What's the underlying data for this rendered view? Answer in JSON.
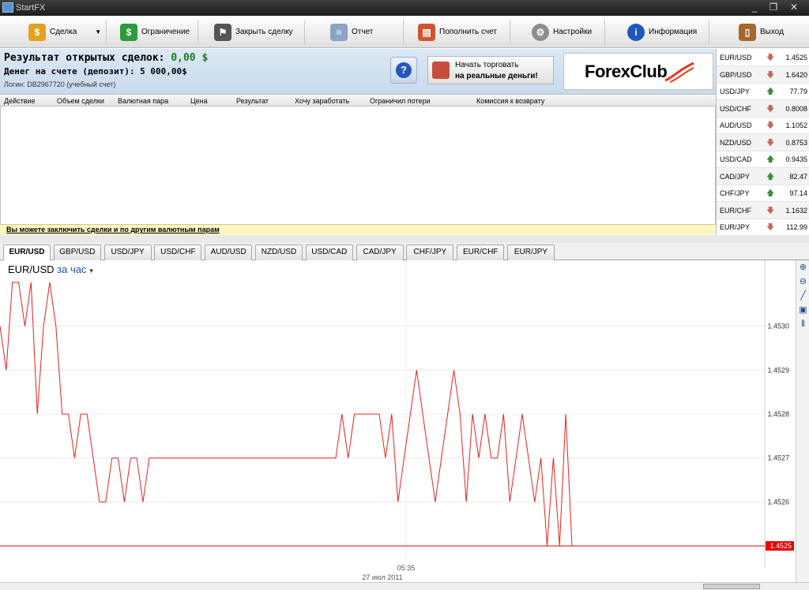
{
  "window": {
    "title": "StartFX"
  },
  "toolbar": {
    "deal": "Сделка",
    "limit": "Ограничение",
    "close_deal": "Закрыть сделку",
    "report": "Отчет",
    "deposit": "Пополнить счет",
    "settings": "Настройки",
    "info": "Информация",
    "exit": "Выход"
  },
  "account": {
    "result_label": "Результат открытых сделок:",
    "result_value": "0,00 $",
    "deposit_text": "Денег на счете (депозит): 5 000,00$",
    "login_text": "Логин: DB2967720 (учебный счет)",
    "help_label": "?",
    "real_money_line1": "Начать торговать",
    "real_money_line2": "на реальные деньги!",
    "logo_text": "ForexClub"
  },
  "table": {
    "columns": [
      "Действие",
      "Объем сделки",
      "Валютная пара",
      "Цена",
      "Результат",
      "Хочу заработать",
      "Ограничил потери",
      "Комиссия к возврату"
    ]
  },
  "notice": "Вы можете заключить сделки и по другим валютным парам",
  "quotes": [
    {
      "pair": "EUR/USD",
      "dir": "down",
      "value": "1.4525"
    },
    {
      "pair": "GBP/USD",
      "dir": "down",
      "value": "1.6420"
    },
    {
      "pair": "USD/JPY",
      "dir": "up",
      "value": "77.79"
    },
    {
      "pair": "USD/CHF",
      "dir": "down",
      "value": "0.8008"
    },
    {
      "pair": "AUD/USD",
      "dir": "down",
      "value": "1.1052"
    },
    {
      "pair": "NZD/USD",
      "dir": "down",
      "value": "0.8753"
    },
    {
      "pair": "USD/CAD",
      "dir": "up",
      "value": "0.9435"
    },
    {
      "pair": "CAD/JPY",
      "dir": "up",
      "value": "82.47"
    },
    {
      "pair": "CHF/JPY",
      "dir": "up",
      "value": "97.14"
    },
    {
      "pair": "EUR/CHF",
      "dir": "down",
      "value": "1.1632"
    },
    {
      "pair": "EUR/JPY",
      "dir": "down",
      "value": "112.99"
    }
  ],
  "tabs": [
    "EUR/USD",
    "GBP/USD",
    "USD/JPY",
    "USD/CHF",
    "AUD/USD",
    "NZD/USD",
    "USD/CAD",
    "CAD/JPY",
    "CHF/JPY",
    "EUR/CHF",
    "EUR/JPY"
  ],
  "active_tab": "EUR/USD",
  "chart": {
    "pair": "EUR/USD",
    "period": "за час",
    "time_label": "05:35",
    "date_label": "27 июл 2011",
    "current_price": "1.4525"
  },
  "colors": {
    "line": "#e82020",
    "price_tag": "#e80000",
    "up": "#3c8a3c",
    "down": "#c86464"
  },
  "chart_data": {
    "type": "line",
    "title": "EUR/USD",
    "y_ticks": [
      1.4526,
      1.4527,
      1.4528,
      1.4529,
      1.453
    ],
    "ylim": [
      1.45245,
      1.45315
    ],
    "series": [
      {
        "values": [
          1.453,
          1.4529,
          1.4531,
          1.4531,
          1.453,
          1.4531,
          1.4528,
          1.453,
          1.4531,
          1.453,
          1.4528,
          1.4528,
          1.4527,
          1.4528,
          1.4528,
          1.4527,
          1.4526,
          1.4526,
          1.4527,
          1.4527,
          1.4526,
          1.4527,
          1.4527,
          1.4526,
          1.4527,
          1.4527,
          1.4527,
          1.4527,
          1.4527,
          1.4527,
          1.4527,
          1.4527,
          1.4527,
          1.4527,
          1.4527,
          1.4527,
          1.4527,
          1.4527,
          1.4527,
          1.4527,
          1.4527,
          1.4527,
          1.4527,
          1.4527,
          1.4527,
          1.4527,
          1.4527,
          1.4527,
          1.4527,
          1.4527,
          1.4527,
          1.4527,
          1.4527,
          1.4527,
          1.4527,
          1.4528,
          1.4527,
          1.4528,
          1.4528,
          1.4528,
          1.4528,
          1.4528,
          1.4527,
          1.4528,
          1.4526,
          1.4527,
          1.4528,
          1.4529,
          1.4528,
          1.4527,
          1.4526,
          1.4527,
          1.4528,
          1.4529,
          1.4528,
          1.4526,
          1.4528,
          1.4527,
          1.4528,
          1.4527,
          1.4527,
          1.4528,
          1.4526,
          1.4527,
          1.4528,
          1.4527,
          1.4526,
          1.4527,
          1.4525,
          1.4527,
          1.4525,
          1.4528,
          1.4525
        ]
      }
    ]
  }
}
